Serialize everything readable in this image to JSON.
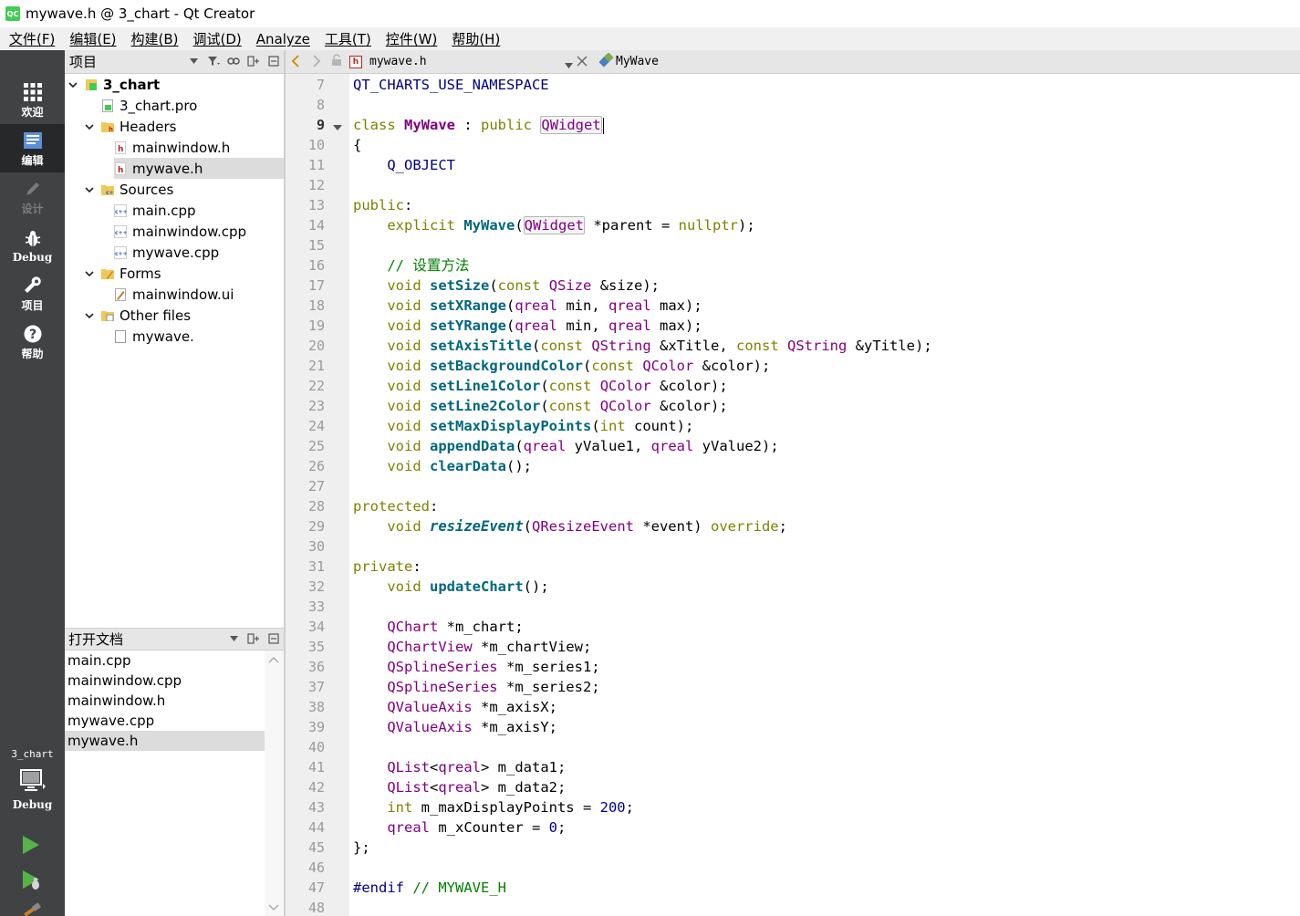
{
  "window": {
    "title": "mywave.h @ 3_chart - Qt Creator",
    "logo_text": "QC"
  },
  "menu": [
    "文件(F)",
    "编辑(E)",
    "构建(B)",
    "调试(D)",
    "Analyze",
    "工具(T)",
    "控件(W)",
    "帮助(H)"
  ],
  "modes": {
    "welcome": "欢迎",
    "edit": "编辑",
    "design": "设计",
    "debug": "Debug",
    "projects": "项目",
    "help": "帮助"
  },
  "kit": {
    "name": "3_chart",
    "build": "Debug"
  },
  "project_pane": {
    "title": "项目",
    "tree": [
      {
        "label": "3_chart",
        "level": 0,
        "kind": "project",
        "expanded": true,
        "bold": true
      },
      {
        "label": "3_chart.pro",
        "level": 1,
        "kind": "pro"
      },
      {
        "label": "Headers",
        "level": 1,
        "kind": "folder-h",
        "expanded": true
      },
      {
        "label": "mainwindow.h",
        "level": 2,
        "kind": "h"
      },
      {
        "label": "mywave.h",
        "level": 2,
        "kind": "h",
        "selected": true
      },
      {
        "label": "Sources",
        "level": 1,
        "kind": "folder-cpp",
        "expanded": true
      },
      {
        "label": "main.cpp",
        "level": 2,
        "kind": "cpp"
      },
      {
        "label": "mainwindow.cpp",
        "level": 2,
        "kind": "cpp"
      },
      {
        "label": "mywave.cpp",
        "level": 2,
        "kind": "cpp"
      },
      {
        "label": "Forms",
        "level": 1,
        "kind": "folder-ui",
        "expanded": true
      },
      {
        "label": "mainwindow.ui",
        "level": 2,
        "kind": "ui"
      },
      {
        "label": "Other files",
        "level": 1,
        "kind": "folder-other",
        "expanded": true
      },
      {
        "label": "mywave.",
        "level": 2,
        "kind": "file"
      }
    ]
  },
  "open_docs": {
    "title": "打开文档",
    "items": [
      "main.cpp",
      "mainwindow.cpp",
      "mainwindow.h",
      "mywave.cpp",
      "mywave.h"
    ],
    "selected": "mywave.h"
  },
  "editor": {
    "file": "mywave.h",
    "symbol": "MyWave",
    "first_line": 7,
    "current_line": 9,
    "lines": [
      [
        [
          "mac",
          "QT_CHARTS_USE_NAMESPACE"
        ]
      ],
      [],
      [
        [
          "kw",
          "class"
        ],
        [
          "",
          " "
        ],
        [
          "cls",
          "MyWave"
        ],
        [
          "",
          " : "
        ],
        [
          "kw",
          "public"
        ],
        [
          "",
          " "
        ],
        [
          "ty hl",
          "QWidget"
        ],
        [
          "caret",
          ""
        ]
      ],
      [
        [
          "",
          "{"
        ]
      ],
      [
        [
          "",
          "    "
        ],
        [
          "mac",
          "Q_OBJECT"
        ]
      ],
      [],
      [
        [
          "kw",
          "public"
        ],
        [
          "",
          ":"
        ]
      ],
      [
        [
          "",
          "    "
        ],
        [
          "kw",
          "explicit"
        ],
        [
          "",
          " "
        ],
        [
          "fn-decl",
          "MyWave"
        ],
        [
          "",
          "("
        ],
        [
          "ty hl",
          "QWidget"
        ],
        [
          "",
          " *parent = "
        ],
        [
          "kw",
          "nullptr"
        ],
        [
          "",
          ");"
        ]
      ],
      [],
      [
        [
          "",
          "    "
        ],
        [
          "cm",
          "// 设置方法"
        ]
      ],
      [
        [
          "",
          "    "
        ],
        [
          "kw",
          "void"
        ],
        [
          "",
          " "
        ],
        [
          "fn-decl",
          "setSize"
        ],
        [
          "",
          "("
        ],
        [
          "kw",
          "const"
        ],
        [
          "",
          " "
        ],
        [
          "ty",
          "QSize"
        ],
        [
          "",
          " &size);"
        ]
      ],
      [
        [
          "",
          "    "
        ],
        [
          "kw",
          "void"
        ],
        [
          "",
          " "
        ],
        [
          "fn-decl",
          "setXRange"
        ],
        [
          "",
          "("
        ],
        [
          "ty",
          "qreal"
        ],
        [
          "",
          " min, "
        ],
        [
          "ty",
          "qreal"
        ],
        [
          "",
          " max);"
        ]
      ],
      [
        [
          "",
          "    "
        ],
        [
          "kw",
          "void"
        ],
        [
          "",
          " "
        ],
        [
          "fn-decl",
          "setYRange"
        ],
        [
          "",
          "("
        ],
        [
          "ty",
          "qreal"
        ],
        [
          "",
          " min, "
        ],
        [
          "ty",
          "qreal"
        ],
        [
          "",
          " max);"
        ]
      ],
      [
        [
          "",
          "    "
        ],
        [
          "kw",
          "void"
        ],
        [
          "",
          " "
        ],
        [
          "fn-decl",
          "setAxisTitle"
        ],
        [
          "",
          "("
        ],
        [
          "kw",
          "const"
        ],
        [
          "",
          " "
        ],
        [
          "ty",
          "QString"
        ],
        [
          "",
          " &xTitle, "
        ],
        [
          "kw",
          "const"
        ],
        [
          "",
          " "
        ],
        [
          "ty",
          "QString"
        ],
        [
          "",
          " &yTitle);"
        ]
      ],
      [
        [
          "",
          "    "
        ],
        [
          "kw",
          "void"
        ],
        [
          "",
          " "
        ],
        [
          "fn-decl",
          "setBackgroundColor"
        ],
        [
          "",
          "("
        ],
        [
          "kw",
          "const"
        ],
        [
          "",
          " "
        ],
        [
          "ty",
          "QColor"
        ],
        [
          "",
          " &color);"
        ]
      ],
      [
        [
          "",
          "    "
        ],
        [
          "kw",
          "void"
        ],
        [
          "",
          " "
        ],
        [
          "fn-decl",
          "setLine1Color"
        ],
        [
          "",
          "("
        ],
        [
          "kw",
          "const"
        ],
        [
          "",
          " "
        ],
        [
          "ty",
          "QColor"
        ],
        [
          "",
          " &color);"
        ]
      ],
      [
        [
          "",
          "    "
        ],
        [
          "kw",
          "void"
        ],
        [
          "",
          " "
        ],
        [
          "fn-decl",
          "setLine2Color"
        ],
        [
          "",
          "("
        ],
        [
          "kw",
          "const"
        ],
        [
          "",
          " "
        ],
        [
          "ty",
          "QColor"
        ],
        [
          "",
          " &color);"
        ]
      ],
      [
        [
          "",
          "    "
        ],
        [
          "kw",
          "void"
        ],
        [
          "",
          " "
        ],
        [
          "fn-decl",
          "setMaxDisplayPoints"
        ],
        [
          "",
          "("
        ],
        [
          "kw",
          "int"
        ],
        [
          "",
          " count);"
        ]
      ],
      [
        [
          "",
          "    "
        ],
        [
          "kw",
          "void"
        ],
        [
          "",
          " "
        ],
        [
          "fn-decl",
          "appendData"
        ],
        [
          "",
          "("
        ],
        [
          "ty",
          "qreal"
        ],
        [
          "",
          " yValue1, "
        ],
        [
          "ty",
          "qreal"
        ],
        [
          "",
          " yValue2);"
        ]
      ],
      [
        [
          "",
          "    "
        ],
        [
          "kw",
          "void"
        ],
        [
          "",
          " "
        ],
        [
          "fn-decl",
          "clearData"
        ],
        [
          "",
          "();"
        ]
      ],
      [],
      [
        [
          "kw",
          "protected"
        ],
        [
          "",
          ":"
        ]
      ],
      [
        [
          "",
          "    "
        ],
        [
          "kw",
          "void"
        ],
        [
          "",
          " "
        ],
        [
          "vir",
          "resizeEvent"
        ],
        [
          "",
          "("
        ],
        [
          "ty",
          "QResizeEvent"
        ],
        [
          "",
          " *event) "
        ],
        [
          "kw",
          "override"
        ],
        [
          "",
          ";"
        ]
      ],
      [],
      [
        [
          "kw",
          "private"
        ],
        [
          "",
          ":"
        ]
      ],
      [
        [
          "",
          "    "
        ],
        [
          "kw",
          "void"
        ],
        [
          "",
          " "
        ],
        [
          "fn-decl",
          "updateChart"
        ],
        [
          "",
          "();"
        ]
      ],
      [],
      [
        [
          "",
          "    "
        ],
        [
          "ty",
          "QChart"
        ],
        [
          "",
          " *m_chart;"
        ]
      ],
      [
        [
          "",
          "    "
        ],
        [
          "ty",
          "QChartView"
        ],
        [
          "",
          " *m_chartView;"
        ]
      ],
      [
        [
          "",
          "    "
        ],
        [
          "ty",
          "QSplineSeries"
        ],
        [
          "",
          " *m_series1;"
        ]
      ],
      [
        [
          "",
          "    "
        ],
        [
          "ty",
          "QSplineSeries"
        ],
        [
          "",
          " *m_series2;"
        ]
      ],
      [
        [
          "",
          "    "
        ],
        [
          "ty",
          "QValueAxis"
        ],
        [
          "",
          " *m_axisX;"
        ]
      ],
      [
        [
          "",
          "    "
        ],
        [
          "ty",
          "QValueAxis"
        ],
        [
          "",
          " *m_axisY;"
        ]
      ],
      [],
      [
        [
          "",
          "    "
        ],
        [
          "ty",
          "QList"
        ],
        [
          "",
          "<"
        ],
        [
          "ty",
          "qreal"
        ],
        [
          "",
          "> m_data1;"
        ]
      ],
      [
        [
          "",
          "    "
        ],
        [
          "ty",
          "QList"
        ],
        [
          "",
          "<"
        ],
        [
          "ty",
          "qreal"
        ],
        [
          "",
          "> m_data2;"
        ]
      ],
      [
        [
          "",
          "    "
        ],
        [
          "kw",
          "int"
        ],
        [
          "",
          " m_maxDisplayPoints = "
        ],
        [
          "num",
          "200"
        ],
        [
          "",
          ";"
        ]
      ],
      [
        [
          "",
          "    "
        ],
        [
          "ty",
          "qreal"
        ],
        [
          "",
          " m_xCounter = "
        ],
        [
          "num",
          "0"
        ],
        [
          "",
          ";"
        ]
      ],
      [
        [
          "",
          "};"
        ]
      ],
      [],
      [
        [
          "pp",
          "#endif"
        ],
        [
          "",
          " "
        ],
        [
          "cm",
          "// MYWAVE_H"
        ]
      ],
      []
    ]
  }
}
